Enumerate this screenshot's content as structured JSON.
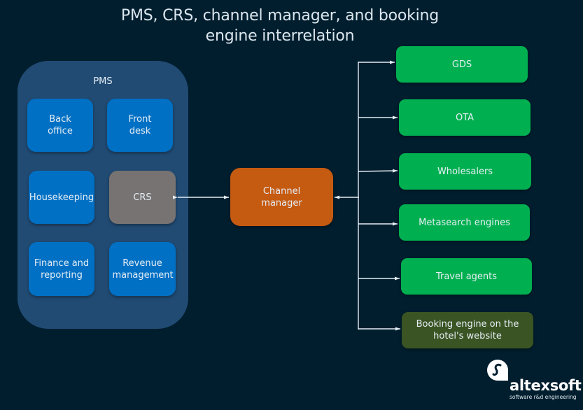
{
  "title": "PMS, CRS, channel manager, and booking engine interrelation",
  "pms": {
    "label": "PMS",
    "modules": [
      {
        "label": "Back office"
      },
      {
        "label": "Front desk"
      },
      {
        "label": "Housekeeping"
      },
      {
        "label": "CRS"
      },
      {
        "label": "Finance and reporting"
      },
      {
        "label": "Revenue management"
      }
    ]
  },
  "channel_manager": {
    "label": "Channel manager"
  },
  "channels": [
    {
      "label": "GDS"
    },
    {
      "label": "OTA"
    },
    {
      "label": "Wholesalers"
    },
    {
      "label": "Metasearch engines"
    },
    {
      "label": "Travel agents"
    },
    {
      "label": "Booking engine on the hotel's website"
    }
  ],
  "colors": {
    "background": "#001e2e",
    "pms_container": "#214b73",
    "module": "#0070c4",
    "crs": "#767372",
    "channel_manager": "#c55a11",
    "channel": "#00b050",
    "booking_engine": "#3a5423"
  },
  "logo": {
    "name": "altexsoft",
    "tagline": "software r&d engineering",
    "icon": "altexsoft-logo-icon"
  }
}
